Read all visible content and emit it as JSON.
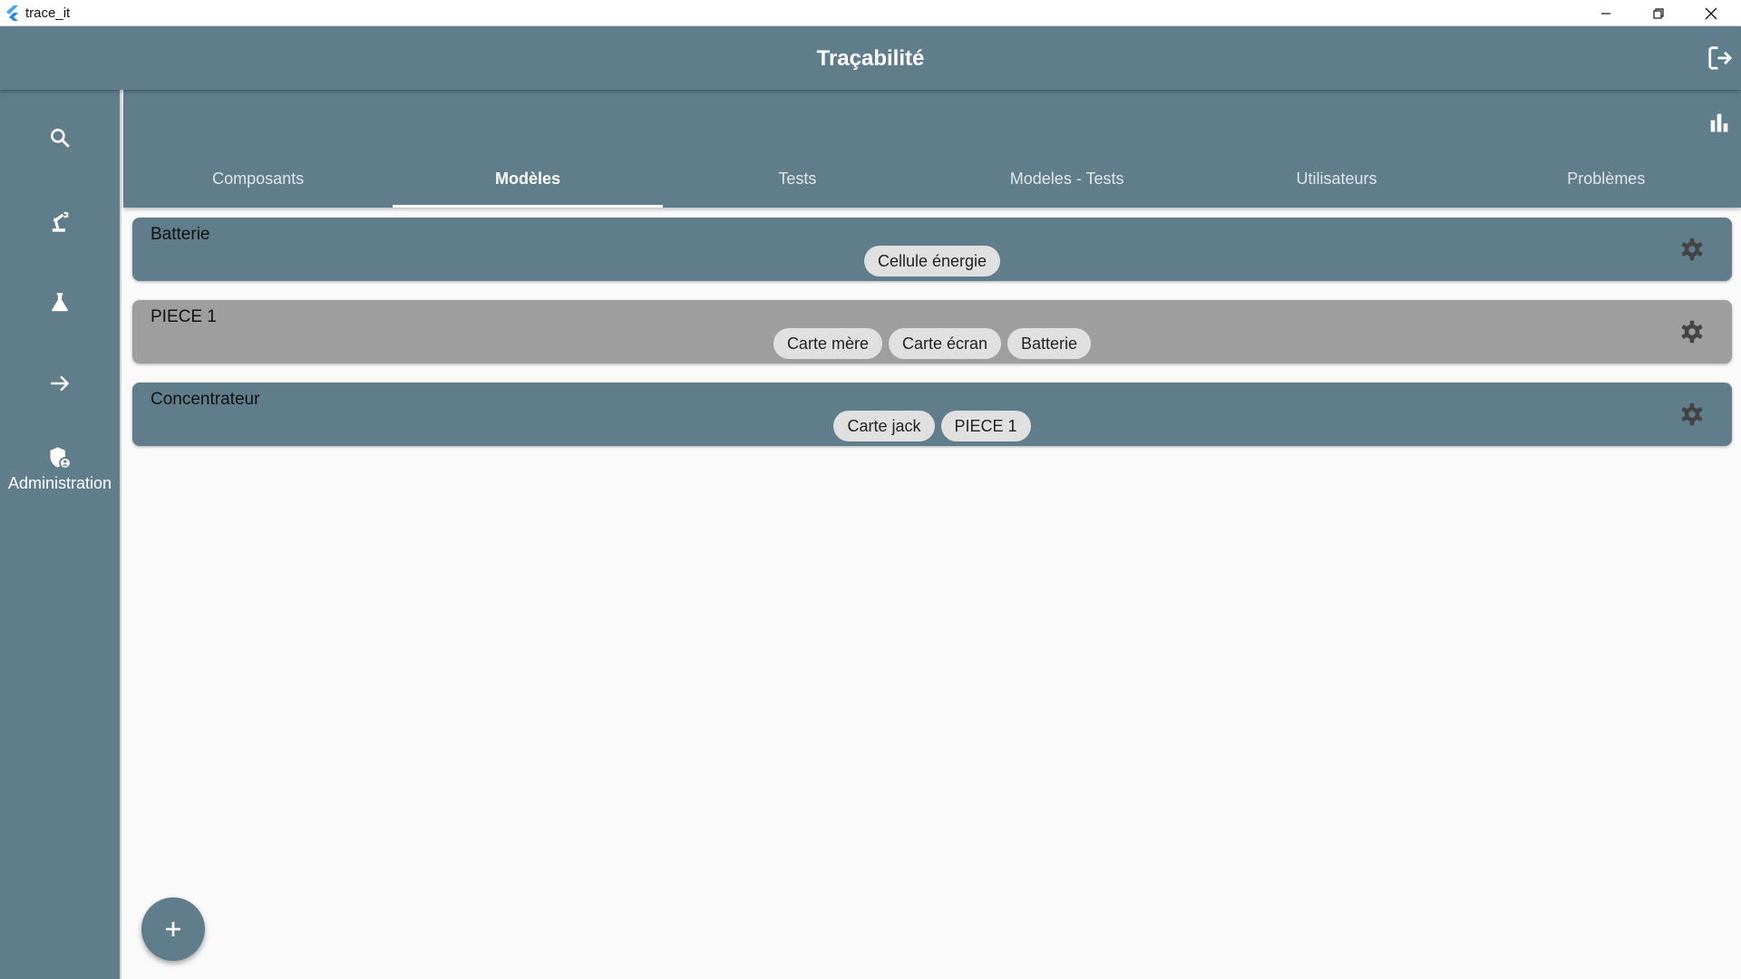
{
  "window": {
    "title": "trace_it"
  },
  "appbar": {
    "title": "Traçabilité"
  },
  "rail": {
    "items": [
      {
        "icon": "search-icon",
        "label": ""
      },
      {
        "icon": "robot-arm-icon",
        "label": ""
      },
      {
        "icon": "flask-icon",
        "label": ""
      },
      {
        "icon": "arrow-right-icon",
        "label": ""
      },
      {
        "icon": "admin-shield-icon",
        "label": "Administration"
      }
    ]
  },
  "tabs": [
    {
      "label": "Composants",
      "active": false
    },
    {
      "label": "Modèles",
      "active": true
    },
    {
      "label": "Tests",
      "active": false
    },
    {
      "label": "Modeles - Tests",
      "active": false
    },
    {
      "label": "Utilisateurs",
      "active": false
    },
    {
      "label": "Problèmes",
      "active": false
    }
  ],
  "models": [
    {
      "name": "Batterie",
      "components": [
        "Cellule énergie"
      ],
      "color": "#607d8b"
    },
    {
      "name": "PIECE 1",
      "components": [
        "Carte mère",
        "Carte écran",
        "Batterie"
      ],
      "color": "#9e9e9e"
    },
    {
      "name": "Concentrateur",
      "components": [
        "Carte jack",
        "PIECE 1"
      ],
      "color": "#607d8b"
    }
  ],
  "colors": {
    "primary": "#607d8b",
    "highlight": "#9e9e9e",
    "chip": "#e0e0e0",
    "background": "#fafafa"
  }
}
